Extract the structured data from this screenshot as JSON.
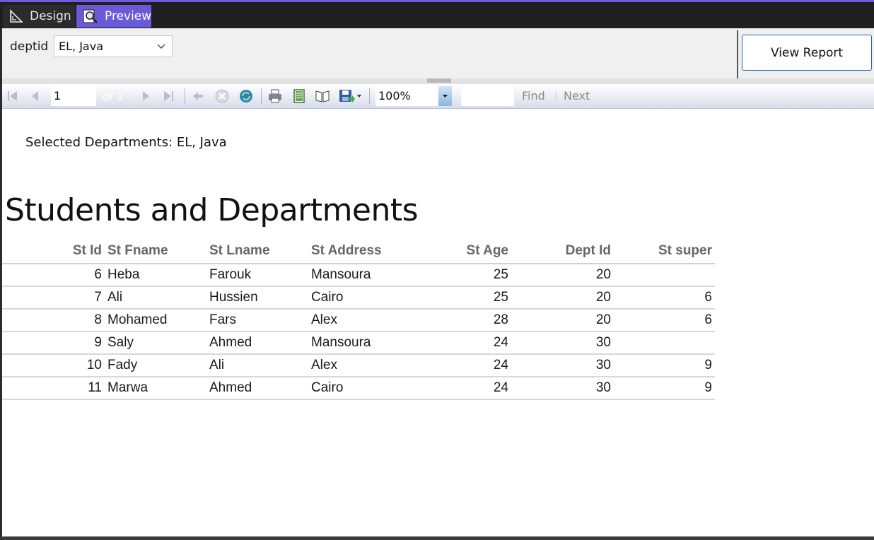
{
  "tabs": {
    "design_label": "Design",
    "preview_label": "Preview"
  },
  "parameters": {
    "label": "deptid",
    "selected_value": "EL, Java",
    "view_report_label": "View Report"
  },
  "toolbar": {
    "page_value": "1",
    "of_text": "of",
    "total_pages": "1",
    "zoom_value": "100%",
    "find_label": "Find",
    "next_label": "Next",
    "icons": [
      "first-page-icon",
      "previous-page-icon",
      "next-page-icon",
      "last-page-icon",
      "back-icon",
      "stop-icon",
      "refresh-icon",
      "print-icon",
      "print-layout-icon",
      "page-setup-icon",
      "export-icon"
    ]
  },
  "report": {
    "selected_text": "Selected Departments: EL, Java",
    "title": "Students and Departments",
    "columns": [
      "St Id",
      "St Fname",
      "St Lname",
      "St Address",
      "St Age",
      "Dept Id",
      "St super"
    ],
    "rows": [
      [
        "6",
        "Heba",
        "Farouk",
        "Mansoura",
        "25",
        "20",
        ""
      ],
      [
        "7",
        "Ali",
        "Hussien",
        "Cairo",
        "25",
        "20",
        "6"
      ],
      [
        "8",
        "Mohamed",
        "Fars",
        "Alex",
        "28",
        "20",
        "6"
      ],
      [
        "9",
        "Saly",
        "Ahmed",
        "Mansoura",
        "24",
        "30",
        ""
      ],
      [
        "10",
        "Fady",
        "Ali",
        "Alex",
        "24",
        "30",
        "9"
      ],
      [
        "11",
        "Marwa",
        "Ahmed",
        "Cairo",
        "24",
        "30",
        "9"
      ]
    ]
  },
  "colors": {
    "accent": "#6a5ad8",
    "button_border": "#2a62b0"
  }
}
